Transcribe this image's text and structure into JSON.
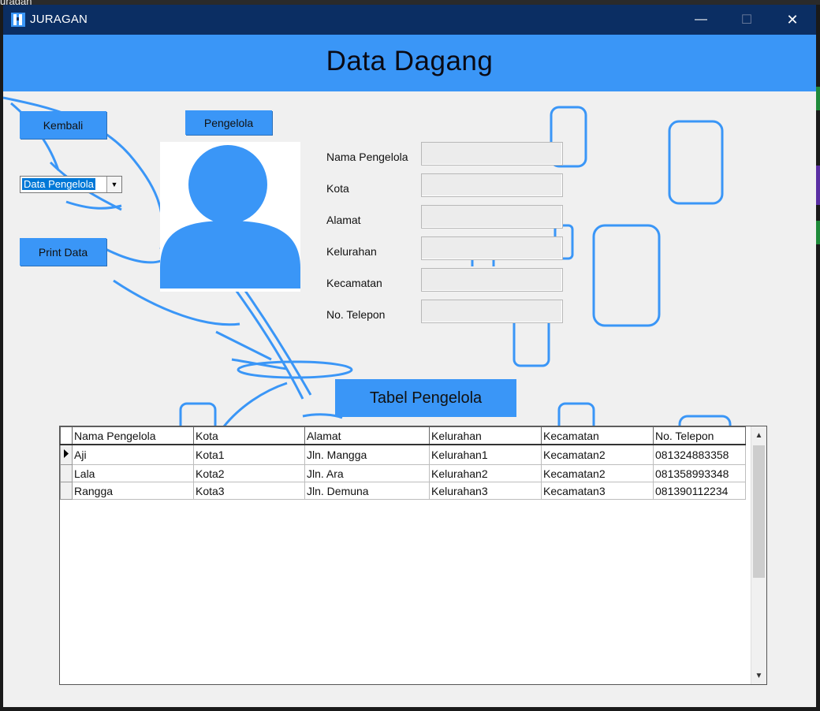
{
  "desktop": {
    "label": "uragan"
  },
  "window": {
    "title": "JURAGAN",
    "minimize_glyph": "—",
    "maximize_glyph": "☐",
    "close_glyph": "✕"
  },
  "header": {
    "title": "Data Dagang"
  },
  "buttons": {
    "kembali": "Kembali",
    "pengelola": "Pengelola",
    "print_data": "Print Data",
    "tabel_pengelola": "Tabel Pengelola"
  },
  "combo": {
    "selected": "Data Pengelola"
  },
  "form": {
    "labels": [
      "Nama Pengelola",
      "Kota",
      "Alamat",
      "Kelurahan",
      "Kecamatan",
      "No. Telepon"
    ],
    "values": [
      "",
      "",
      "",
      "",
      "",
      ""
    ]
  },
  "table": {
    "columns": [
      "Nama Pengelola",
      "Kota",
      "Alamat",
      "Kelurahan",
      "Kecamatan",
      "No. Telepon"
    ],
    "rows": [
      [
        "Aji",
        "Kota1",
        "Jln. Mangga",
        "Kelurahan1",
        "Kecamatan2",
        "081324883358"
      ],
      [
        "Lala",
        "Kota2",
        "Jln. Ara",
        "Kelurahan2",
        "Kecamatan2",
        "081358993348"
      ],
      [
        "Rangga",
        "Kota3",
        "Jln. Demuna",
        "Kelurahan3",
        "Kecamatan3",
        "081390112234"
      ]
    ],
    "current_row": 0
  },
  "icons": {
    "app": "juragan-app-icon",
    "avatar": "user-avatar-icon",
    "combo_arrow": "chevron-down-icon",
    "row_pointer": "row-pointer-icon",
    "scroll_up": "scroll-up-icon",
    "scroll_down": "scroll-down-icon"
  },
  "colors": {
    "title_bar": "#0b2e63",
    "accent": "#3a96f7",
    "window_bg": "#f0f0f0"
  }
}
